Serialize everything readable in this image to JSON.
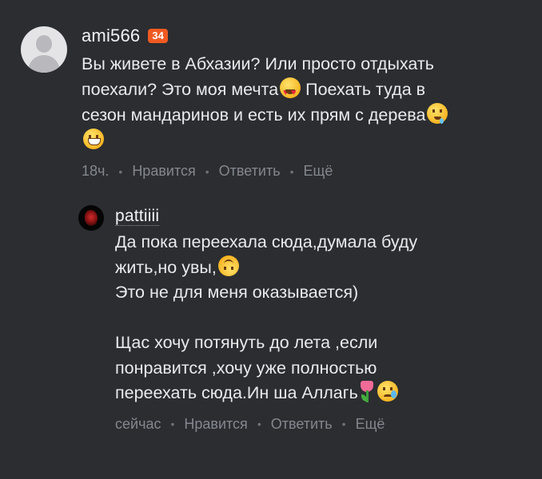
{
  "comments": [
    {
      "author": "ami566",
      "badge": "34",
      "text": {
        "part1": "Вы живете в Абхазии? Или просто отдыхать\nпоехали? Это моя мечта",
        "part2": " Поехать туда в\nсезон мандаринов и есть их прям с дерева",
        "part3": "\n"
      },
      "time": "18ч.",
      "like_label": "Нравится",
      "reply_label": "Ответить",
      "more_label": "Ещё"
    }
  ],
  "reply": {
    "author": "pattiiii",
    "text": {
      "part1": "Да пока переехала сюда,думала буду\nжить,но увы,",
      "part2": "\nЭто не для меня оказывается)\n\nЩас хочу потянуть до лета ,если\nпонравится ,хочу уже полностью\nпереехать сюда.Ин ша Аллагь"
    },
    "time": "сейчас",
    "like_label": "Нравится",
    "reply_label": "Ответить",
    "more_label": "Ещё"
  },
  "icons": {
    "emoji1": "heart-eyes-emoji",
    "emoji2": "drooling-emoji",
    "emoji3": "grinning-emoji",
    "emoji4": "upside-down-emoji",
    "emoji5": "tulip-emoji",
    "emoji6": "crying-smile-emoji"
  },
  "colors": {
    "background": "#2b2d31",
    "badge": "#f05a22",
    "muted": "#84878e"
  }
}
